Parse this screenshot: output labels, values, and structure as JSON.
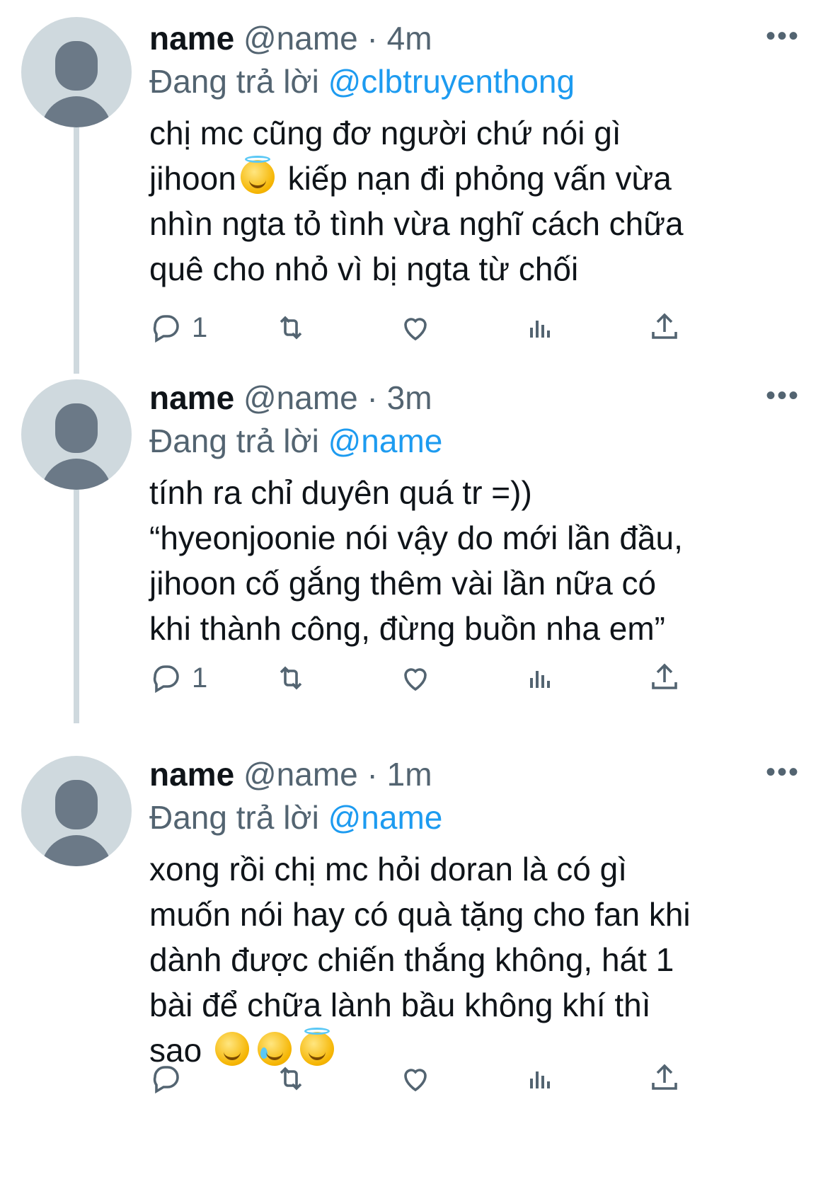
{
  "tweets": [
    {
      "display_name": "name",
      "handle": "@name",
      "dot": "·",
      "time": "4m",
      "more": "•••",
      "replying_prefix": "Đang trả lời",
      "replying_to": "@clbtruyenthong",
      "text_lines": [
        "chị mc cũng đơ người chứ nói gì",
        "jihoon",
        "kiếp nạn đi phỏng vấn vừa",
        "nhìn ngta tỏ tình vừa nghĩ cách chữa",
        "quê cho nhỏ vì bị ngta từ chối"
      ],
      "emojis": [
        "smiling-face-with-halo"
      ],
      "reply_count": "1"
    },
    {
      "display_name": "name",
      "handle": "@name",
      "dot": "·",
      "time": "3m",
      "more": "•••",
      "replying_prefix": "Đang trả lời",
      "replying_to": "@name",
      "text_lines": [
        "tính ra chỉ duyên quá tr =))",
        "“hyeonjoonie nói vậy do mới lần đầu,",
        "jihoon cố gắng thêm vài lần nữa có",
        "khi thành công, đừng buồn nha em”"
      ],
      "reply_count": "1"
    },
    {
      "display_name": "name",
      "handle": "@name",
      "dot": "·",
      "time": "1m",
      "more": "•••",
      "replying_prefix": "Đang trả lời",
      "replying_to": "@name",
      "text_lines": [
        "xong rồi chị mc hỏi doran là có gì",
        "muốn nói hay có quà tặng cho fan khi",
        "dành được chiến thắng không, hát 1",
        "bài để chữa lành bầu không khí thì",
        "sao"
      ],
      "emojis": [
        "grinning-face",
        "face-holding-back-tears",
        "smiling-face-with-halo"
      ],
      "reply_count": ""
    }
  ],
  "icons": {
    "reply": "reply-icon",
    "retweet": "retweet-icon",
    "like": "heart-icon",
    "views": "analytics-icon",
    "share": "share-icon"
  },
  "colors": {
    "link": "#1d9bf0",
    "secondary": "#536471",
    "primary_text": "#0f1419",
    "avatar_bg": "#cfd9de",
    "avatar_fg": "#6b7987"
  }
}
